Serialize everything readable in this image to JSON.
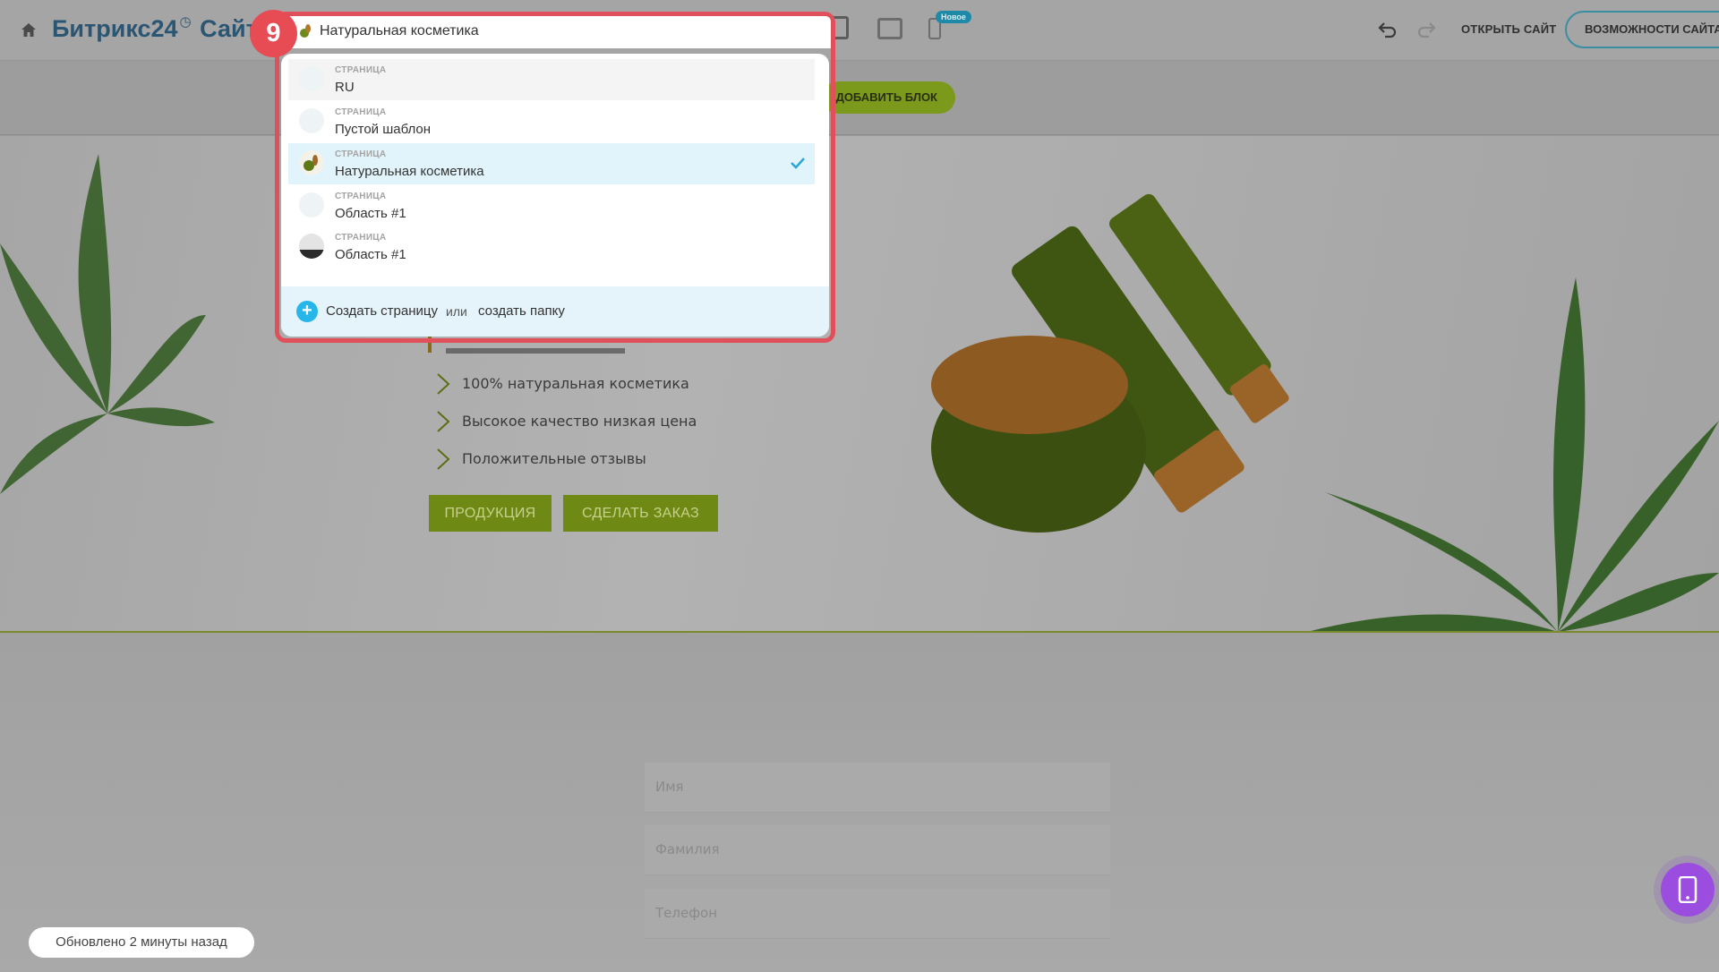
{
  "header": {
    "brand_main": "Битрикс24",
    "brand_clock": "◷",
    "brand_sites": "Сайты",
    "new_badge": "Новое",
    "open_site": "ОТКРЫТЬ САЙТ",
    "features": "ВОЗМОЖНОСТИ САЙТА"
  },
  "toolbar": {
    "add_block": "ДОБАВИТЬ БЛОК"
  },
  "hero": {
    "bullets": [
      "100% натуральная косметика",
      "Высокое качество низкая цена",
      "Положительные отзывы"
    ],
    "button_products": "ПРОДУКЦИЯ",
    "button_order": "СДЕЛАТЬ ЗАКАЗ"
  },
  "form": {
    "fields": [
      "Имя",
      "Фамилия",
      "Телефон"
    ]
  },
  "status": {
    "updated": "Обновлено 2 минуты назад"
  },
  "step_badge": "9",
  "page_selector": {
    "current": "Натуральная косметика",
    "items": [
      {
        "type": "СТРАНИЦА",
        "name": "RU"
      },
      {
        "type": "СТРАНИЦА",
        "name": "Пустой шаблон"
      },
      {
        "type": "СТРАНИЦА",
        "name": "Натуральная косметика",
        "selected": true
      },
      {
        "type": "СТРАНИЦА",
        "name": "Область #1"
      },
      {
        "type": "СТРАНИЦА",
        "name": "Область #1"
      }
    ],
    "create_page": "Создать страницу",
    "or": "или",
    "create_folder": "создать папку"
  },
  "colors": {
    "highlight_frame": "#e0505a",
    "accent_blue": "#26b6ea",
    "brand_green": "#6f8a14"
  }
}
